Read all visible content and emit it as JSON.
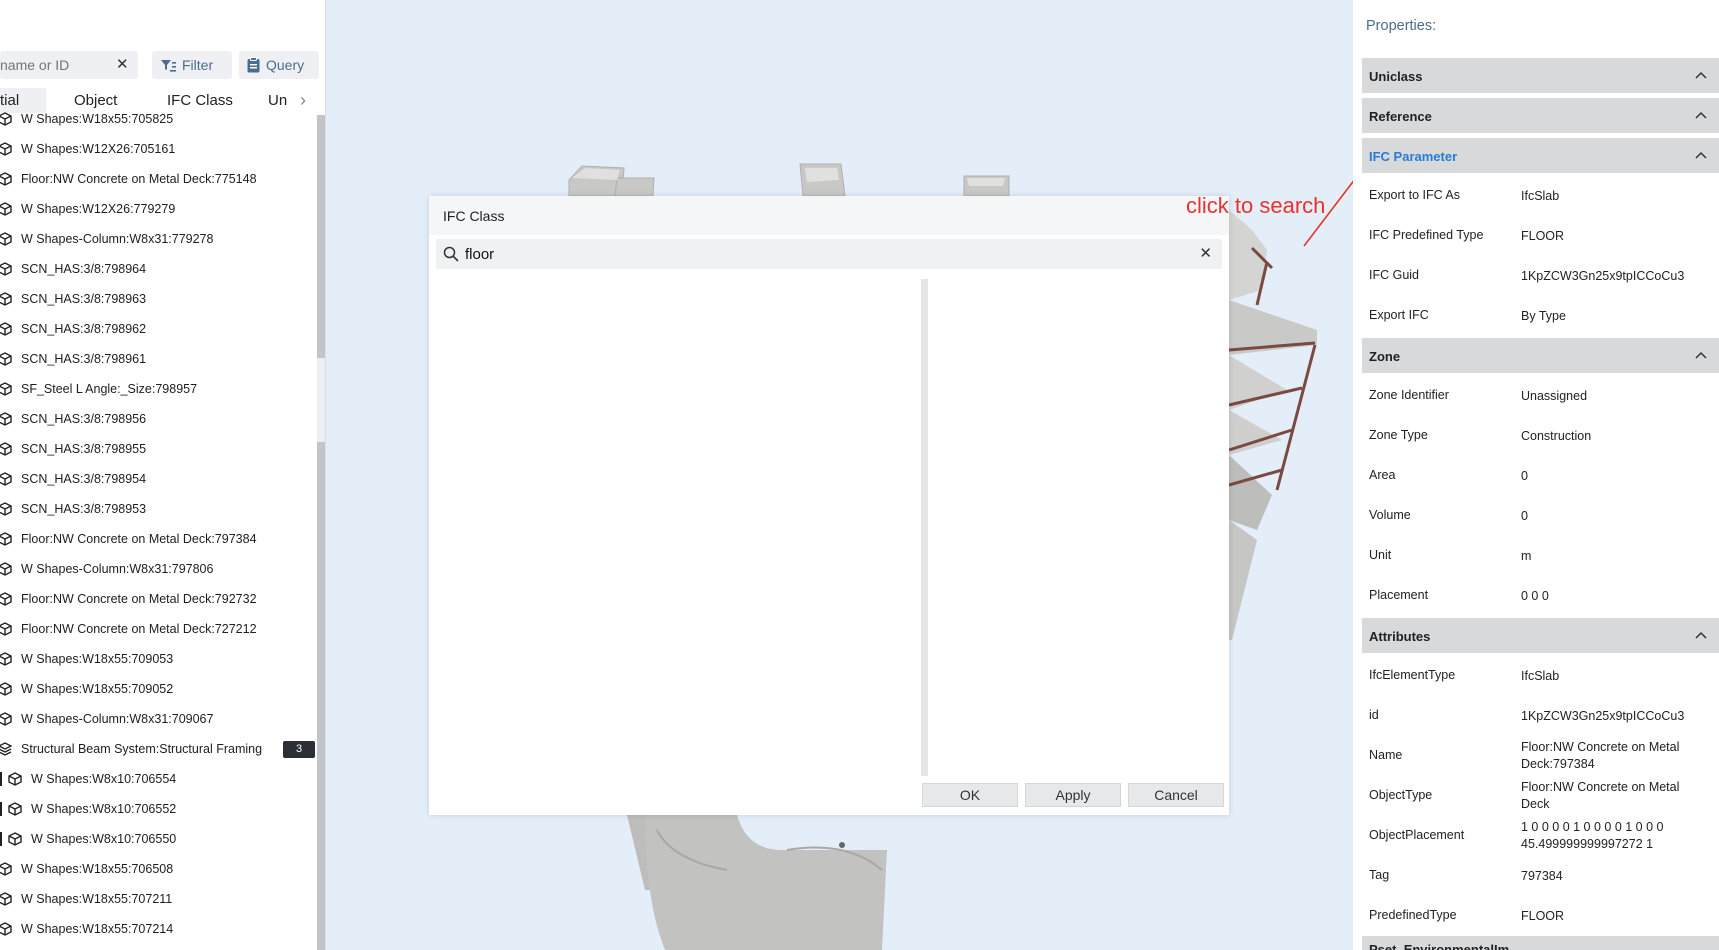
{
  "left_panel": {
    "search_placeholder": "name or ID",
    "filter_label": "Filter",
    "query_label": "Query",
    "tabs": [
      "tial",
      "Object",
      "IFC Class",
      "Un"
    ],
    "tree": [
      {
        "label": "W Shapes:W18x55:705825",
        "child": false
      },
      {
        "label": "W Shapes:W12X26:705161",
        "child": false
      },
      {
        "label": "Floor:NW Concrete on Metal Deck:775148",
        "child": false
      },
      {
        "label": "W Shapes:W12X26:779279",
        "child": false
      },
      {
        "label": "W Shapes-Column:W8x31:779278",
        "child": false
      },
      {
        "label": "SCN_HAS:3/8:798964",
        "child": false
      },
      {
        "label": "SCN_HAS:3/8:798963",
        "child": false
      },
      {
        "label": "SCN_HAS:3/8:798962",
        "child": false
      },
      {
        "label": "SCN_HAS:3/8:798961",
        "child": false
      },
      {
        "label": "SF_Steel L Angle:_Size:798957",
        "child": false
      },
      {
        "label": "SCN_HAS:3/8:798956",
        "child": false
      },
      {
        "label": "SCN_HAS:3/8:798955",
        "child": false
      },
      {
        "label": "SCN_HAS:3/8:798954",
        "child": false
      },
      {
        "label": "SCN_HAS:3/8:798953",
        "child": false
      },
      {
        "label": "Floor:NW Concrete on Metal Deck:797384",
        "child": false
      },
      {
        "label": "W Shapes-Column:W8x31:797806",
        "child": false
      },
      {
        "label": "Floor:NW Concrete on Metal Deck:792732",
        "child": false
      },
      {
        "label": "Floor:NW Concrete on Metal Deck:727212",
        "child": false
      },
      {
        "label": "W Shapes:W18x55:709053",
        "child": false
      },
      {
        "label": "W Shapes:W18x55:709052",
        "child": false
      },
      {
        "label": "W Shapes-Column:W8x31:709067",
        "child": false
      },
      {
        "label": "Structural Beam System:Structural Framing",
        "child": false,
        "badge": "3"
      },
      {
        "label": "W Shapes:W8x10:706554",
        "child": true
      },
      {
        "label": "W Shapes:W8x10:706552",
        "child": true
      },
      {
        "label": "W Shapes:W8x10:706550",
        "child": true
      },
      {
        "label": "W Shapes:W18x55:706508",
        "child": false
      },
      {
        "label": "W Shapes:W18x55:707211",
        "child": false
      },
      {
        "label": "W Shapes:W18x55:707214",
        "child": false
      }
    ]
  },
  "dialog": {
    "title": "IFC Class",
    "search_value": "floor",
    "ok_label": "OK",
    "apply_label": "Apply",
    "cancel_label": "Cancel"
  },
  "annotation": {
    "text": "click to search",
    "color": "#e8322e"
  },
  "properties": {
    "title": "Properties:",
    "sections": {
      "uniclass": "Uniclass",
      "reference": "Reference",
      "ifc_parameter": "IFC Parameter",
      "zone": "Zone",
      "attributes": "Attributes",
      "pset": "Pset_EnvironmentalIm"
    },
    "ifc_parameter_rows": [
      {
        "key": "Export to IFC As",
        "value": "IfcSlab"
      },
      {
        "key": "IFC Predefined Type",
        "value": "FLOOR"
      },
      {
        "key": "IFC Guid",
        "value": "1KpZCW3Gn25x9tpICCoCu3"
      },
      {
        "key": "Export IFC",
        "value": "By Type"
      }
    ],
    "zone_rows": [
      {
        "key": "Zone Identifier",
        "value": "Unassigned"
      },
      {
        "key": "Zone Type",
        "value": "Construction"
      },
      {
        "key": "Area",
        "value": "0"
      },
      {
        "key": "Volume",
        "value": "0"
      },
      {
        "key": "Unit",
        "value": "m"
      },
      {
        "key": "Placement",
        "value": "0 0 0"
      }
    ],
    "attribute_rows": [
      {
        "key": "IfcElementType",
        "value": "IfcSlab"
      },
      {
        "key": "id",
        "value": "1KpZCW3Gn25x9tpICCoCu3"
      },
      {
        "key": "Name",
        "value": "Floor:NW Concrete on Metal Deck:797384"
      },
      {
        "key": "ObjectType",
        "value": "Floor:NW Concrete on Metal Deck"
      },
      {
        "key": "ObjectPlacement",
        "value": "1 0 0 0 0 1 0 0 0 0 1 0 0 0 45.499999999997272 1"
      },
      {
        "key": "Tag",
        "value": "797384"
      },
      {
        "key": "PredefinedType",
        "value": "FLOOR"
      }
    ]
  },
  "colors": {
    "accent": "#2a7bd8",
    "toolbar_text": "#4b6d8e",
    "section_bg": "#d8d9db",
    "viewport_bg": "#e3eef9"
  }
}
